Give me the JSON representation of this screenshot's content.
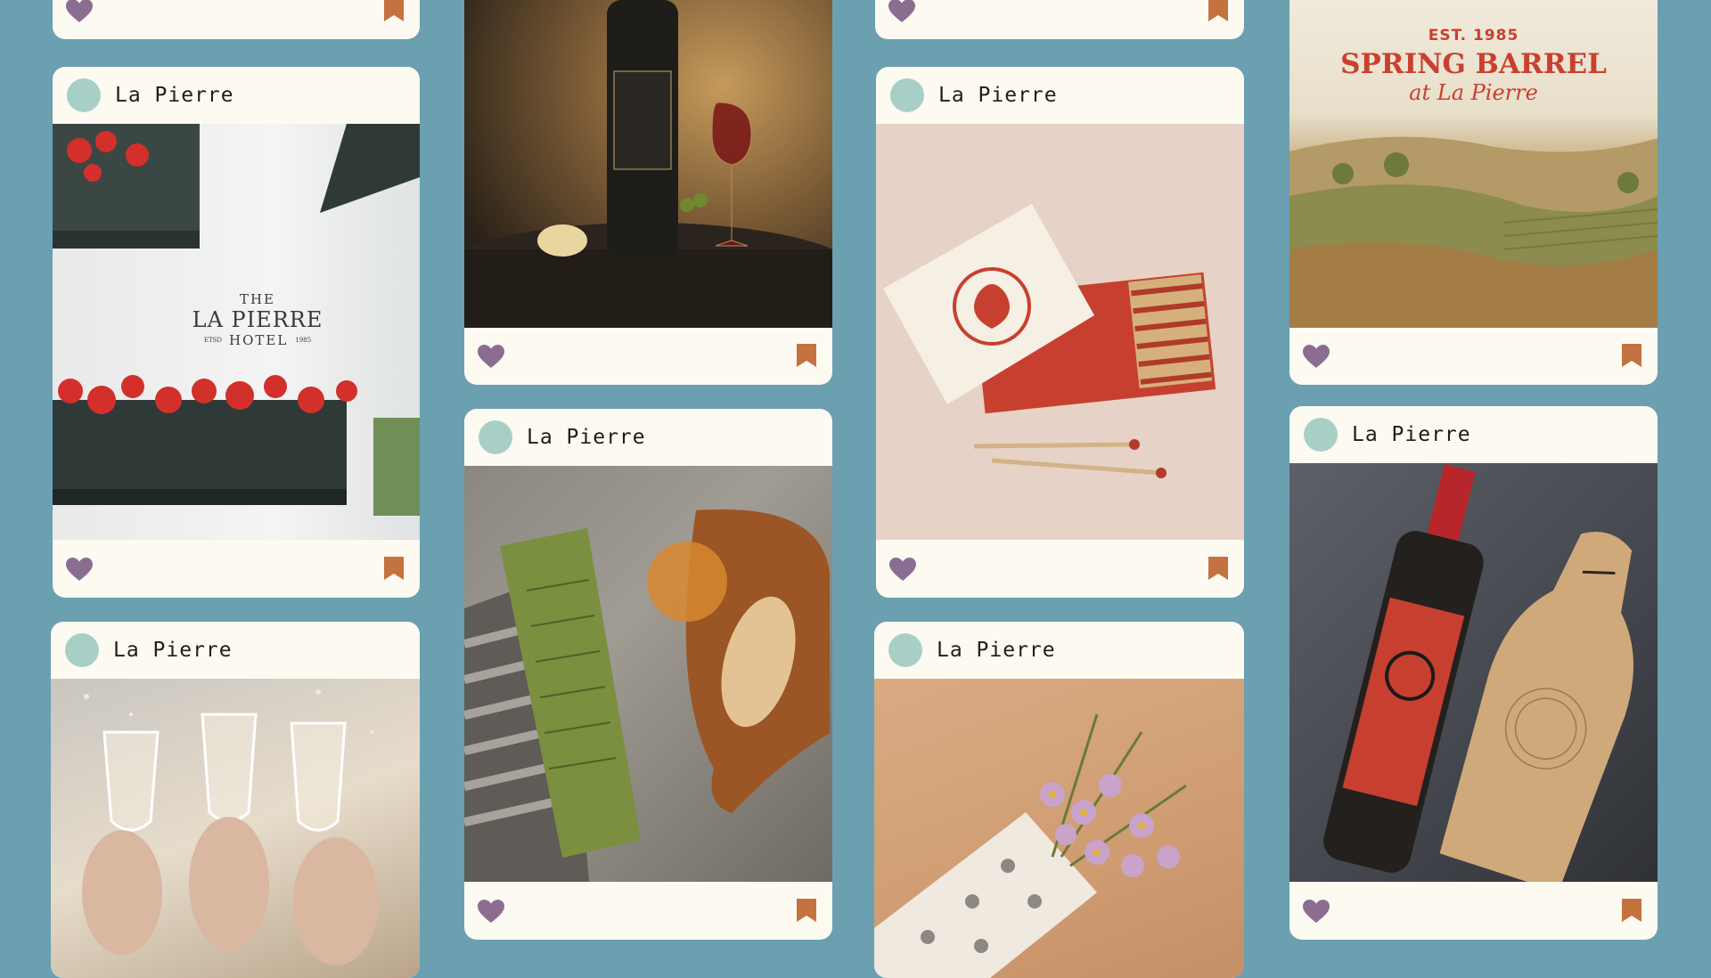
{
  "colors": {
    "background": "#6aa0b0",
    "card": "#fdfaf2",
    "avatar": "#a8cfc6",
    "heart": "#8c6d92",
    "bookmark": "#c4723f"
  },
  "cards": [
    {
      "handle": ""
    },
    {
      "handle": "La Pierre",
      "photo": {
        "line1": "THE",
        "line2": "LA PIERRE",
        "line3": "HOTEL",
        "left": "ETSD",
        "right": "1985"
      }
    },
    {
      "handle": "La Pierre"
    },
    {
      "handle": ""
    },
    {
      "handle": "La Pierre"
    },
    {
      "handle": ""
    },
    {
      "handle": "La Pierre"
    },
    {
      "handle": "La Pierre"
    },
    {
      "handle": "",
      "photo": {
        "est": "EST. 1985",
        "title": "SPRING BARREL",
        "sub": "at La Pierre"
      }
    },
    {
      "handle": "La Pierre"
    }
  ],
  "icons": {
    "like": "heart-icon",
    "save": "bookmark-icon"
  }
}
